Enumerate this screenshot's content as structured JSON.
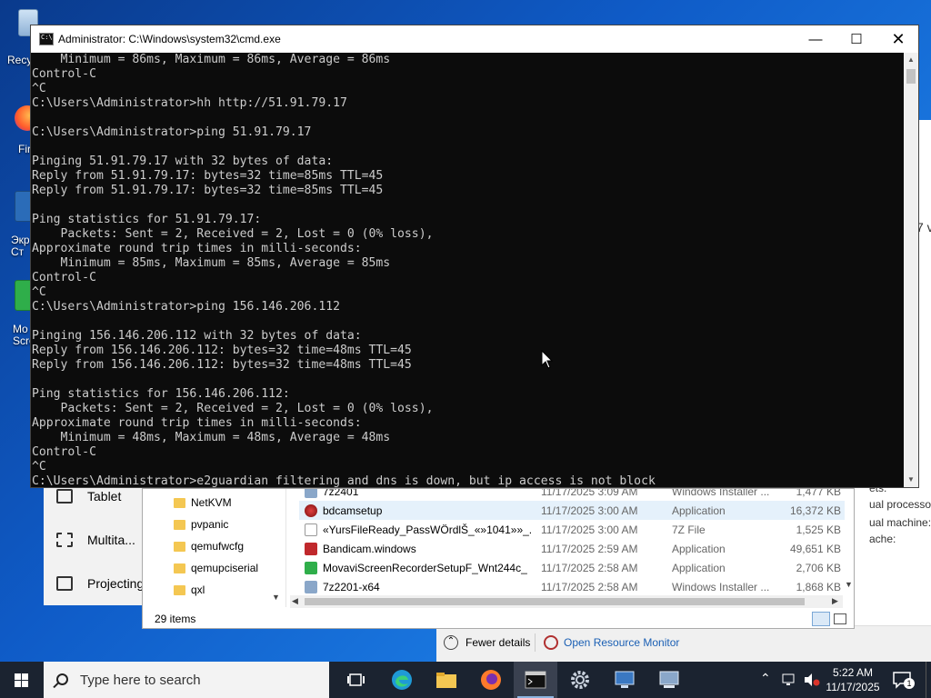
{
  "desktop": {
    "icons": [
      {
        "label": "Recy",
        "name": "recycle-bin"
      },
      {
        "label": "Fir",
        "name": "firefox"
      },
      {
        "label": "Экр\nСт",
        "name": "screen-app"
      },
      {
        "label": "Mo\nScre",
        "name": "movavi-screen"
      }
    ]
  },
  "settings_window": {
    "items": [
      "Tablet",
      "Multita...",
      "Projecting"
    ]
  },
  "explorer": {
    "tree": [
      "NetKVM",
      "pvpanic",
      "qemufwcfg",
      "qemupciserial",
      "qxl"
    ],
    "rows": [
      {
        "name": "7z2401",
        "date": "11/17/2025 3:09 AM",
        "type": "Windows Installer ...",
        "size": "1,477 KB"
      },
      {
        "name": "bdcamsetup",
        "date": "11/17/2025 3:00 AM",
        "type": "Application",
        "size": "16,372 KB"
      },
      {
        "name": "«YursFileReady_PassWÖrdlŠ_«»1041»»_...",
        "date": "11/17/2025 3:00 AM",
        "type": "7Z File",
        "size": "1,525 KB"
      },
      {
        "name": "Bandicam.windows",
        "date": "11/17/2025 2:59 AM",
        "type": "Application",
        "size": "49,651 KB"
      },
      {
        "name": "MovaviScreenRecorderSetupF_Wnt244c_",
        "date": "11/17/2025 2:58 AM",
        "type": "Application",
        "size": "2,706 KB"
      },
      {
        "name": "7z2201-x64",
        "date": "11/17/2025 2:58 AM",
        "type": "Windows Installer ...",
        "size": "1,868 KB"
      }
    ],
    "status": "29 items"
  },
  "task_manager": {
    "side_texts": [
      "7 v",
      "ets:",
      "ual processors:",
      "ual machine:",
      "ache:"
    ],
    "fewer_details": "Fewer details",
    "open_resource_monitor": "Open Resource Monitor"
  },
  "cmd": {
    "title": "Administrator: C:\\Windows\\system32\\cmd.exe",
    "lines": [
      "    Minimum = 86ms, Maximum = 86ms, Average = 86ms",
      "Control-C",
      "^C",
      "C:\\Users\\Administrator>hh http://51.91.79.17",
      "",
      "C:\\Users\\Administrator>ping 51.91.79.17",
      "",
      "Pinging 51.91.79.17 with 32 bytes of data:",
      "Reply from 51.91.79.17: bytes=32 time=85ms TTL=45",
      "Reply from 51.91.79.17: bytes=32 time=85ms TTL=45",
      "",
      "Ping statistics for 51.91.79.17:",
      "    Packets: Sent = 2, Received = 2, Lost = 0 (0% loss),",
      "Approximate round trip times in milli-seconds:",
      "    Minimum = 85ms, Maximum = 85ms, Average = 85ms",
      "Control-C",
      "^C",
      "C:\\Users\\Administrator>ping 156.146.206.112",
      "",
      "Pinging 156.146.206.112 with 32 bytes of data:",
      "Reply from 156.146.206.112: bytes=32 time=48ms TTL=45",
      "Reply from 156.146.206.112: bytes=32 time=48ms TTL=45",
      "",
      "Ping statistics for 156.146.206.112:",
      "    Packets: Sent = 2, Received = 2, Lost = 0 (0% loss),",
      "Approximate round trip times in milli-seconds:",
      "    Minimum = 48ms, Maximum = 48ms, Average = 48ms",
      "Control-C",
      "^C",
      "C:\\Users\\Administrator>e2guardian filtering and dns is down, but ip access is not block"
    ]
  },
  "taskbar": {
    "search_placeholder": "Type here to search",
    "time": "5:22 AM",
    "date": "11/17/2025",
    "notification_count": "1",
    "apps": [
      "task-view",
      "edge",
      "file-explorer",
      "firefox",
      "cmd",
      "settings",
      "network-app",
      "remote-app"
    ]
  },
  "colors": {
    "console_bg": "#0c0c0c",
    "console_text": "#cccccc",
    "taskbar_bg": "#1b2330",
    "explorer_selection": "#e5f1fb"
  }
}
